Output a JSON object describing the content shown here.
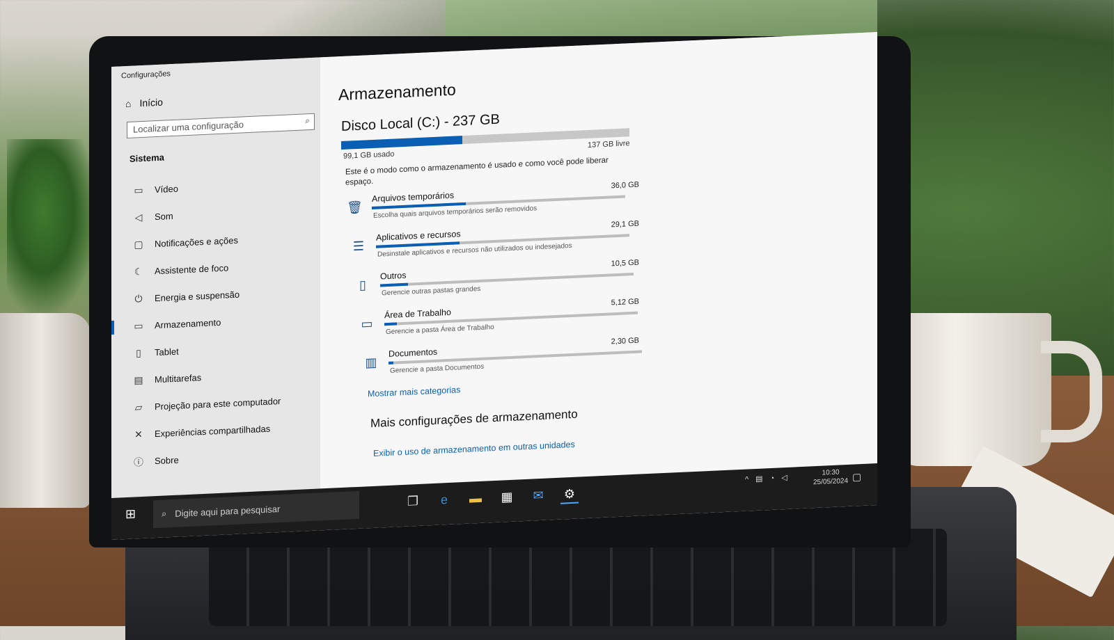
{
  "window": {
    "title": "Configurações"
  },
  "sidebar": {
    "home_label": "Início",
    "search_placeholder": "Localizar uma configuração",
    "section": "Sistema",
    "items": [
      {
        "label": "Vídeo",
        "icon": "monitor-icon"
      },
      {
        "label": "Som",
        "icon": "speaker-icon"
      },
      {
        "label": "Notificações e ações",
        "icon": "notification-icon"
      },
      {
        "label": "Assistente de foco",
        "icon": "moon-icon"
      },
      {
        "label": "Energia e suspensão",
        "icon": "power-icon"
      },
      {
        "label": "Armazenamento",
        "icon": "storage-icon",
        "active": true
      },
      {
        "label": "Tablet",
        "icon": "tablet-icon"
      },
      {
        "label": "Multitarefas",
        "icon": "multitask-icon"
      },
      {
        "label": "Projeção para este computador",
        "icon": "projection-icon"
      },
      {
        "label": "Experiências compartilhadas",
        "icon": "shared-icon"
      },
      {
        "label": "Sobre",
        "icon": "info-icon"
      }
    ]
  },
  "main": {
    "title": "Armazenamento",
    "disk": {
      "name": "Disco Local (C:) - 237 GB",
      "used": "99,1 GB usado",
      "free": "137 GB livre",
      "used_fraction": 0.42
    },
    "description": "Este é o modo como o armazenamento é usado e como você pode liberar espaço.",
    "categories": [
      {
        "name": "Arquivos temporários",
        "size": "36,0 GB",
        "sub": "Escolha quais arquivos temporários serão removidos",
        "fraction": 0.37,
        "icon": "trash-icon"
      },
      {
        "name": "Aplicativos e recursos",
        "size": "29,1 GB",
        "sub": "Desinstale aplicativos e recursos não utilizados ou indesejados",
        "fraction": 0.33,
        "icon": "apps-icon"
      },
      {
        "name": "Outros",
        "size": "10,5 GB",
        "sub": "Gerencie outras pastas grandes",
        "fraction": 0.11,
        "icon": "folder-icon"
      },
      {
        "name": "Área de Trabalho",
        "size": "5,12 GB",
        "sub": "Gerencie a pasta Área de Trabalho",
        "fraction": 0.05,
        "icon": "desktop-icon"
      },
      {
        "name": "Documentos",
        "size": "2,30 GB",
        "sub": "Gerencie a pasta Documentos",
        "fraction": 0.02,
        "icon": "documents-icon"
      }
    ],
    "show_more": "Mostrar mais categorias",
    "more_title": "Mais configurações de armazenamento",
    "more_link": "Exibir o uso de armazenamento em outras unidades"
  },
  "taskbar": {
    "search_placeholder": "Digite aqui para pesquisar",
    "time": "10:30",
    "date": "25/05/2024"
  },
  "colors": {
    "accent": "#0a5fb4",
    "taskbar": "#1c1c1c"
  }
}
